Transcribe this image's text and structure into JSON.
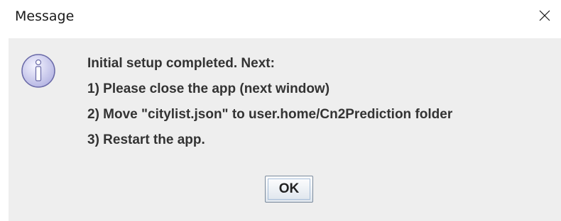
{
  "window": {
    "title": "Message",
    "close_icon": "close-icon"
  },
  "dialog": {
    "icon": "info-icon",
    "lines": [
      "Initial setup completed. Next:",
      "1) Please close the app (next window)",
      "2) Move \"citylist.json\" to user.home/Cn2Prediction folder",
      "3) Restart the app."
    ],
    "ok_label": "OK"
  },
  "colors": {
    "background": "#eeeeee",
    "titlebar": "#ffffff",
    "text": "#333333",
    "icon_fill": "#c8c8ea",
    "icon_stroke": "#6a6aa8"
  }
}
